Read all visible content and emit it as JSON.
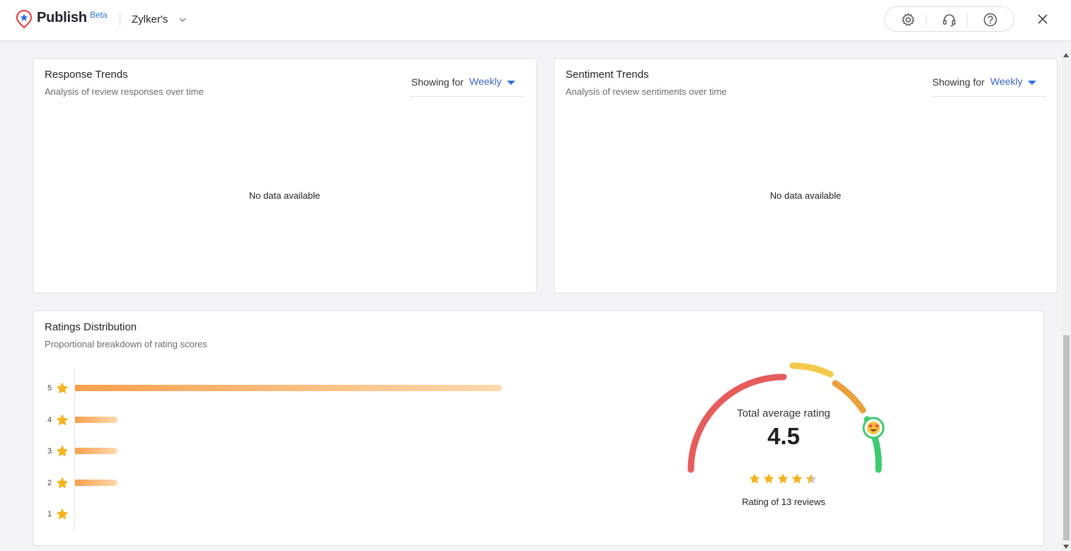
{
  "app": {
    "brand": "Publish",
    "badge": "Beta",
    "org": "Zylker's"
  },
  "header_tools": [
    "settings-icon",
    "headset-icon",
    "help-icon"
  ],
  "response_trends": {
    "title": "Response Trends",
    "subtitle": "Analysis of review responses over time",
    "showing_label": "Showing for",
    "showing_value": "Weekly",
    "empty": "No data available"
  },
  "sentiment_trends": {
    "title": "Sentiment Trends",
    "subtitle": "Analysis of review sentiments over time",
    "showing_label": "Showing for",
    "showing_value": "Weekly",
    "empty": "No data available"
  },
  "ratings": {
    "title": "Ratings Distribution",
    "subtitle": "Proportional breakdown of rating scores",
    "rows": [
      {
        "stars": "5",
        "fraction": 1.0
      },
      {
        "stars": "4",
        "fraction": 0.1
      },
      {
        "stars": "3",
        "fraction": 0.1
      },
      {
        "stars": "2",
        "fraction": 0.1
      },
      {
        "stars": "1",
        "fraction": 0.0
      }
    ],
    "gauge_title": "Total average rating",
    "average": "4.5",
    "average_value": 4.5,
    "count_text": "Rating of 13 reviews",
    "colors": {
      "red": "#e65c5c",
      "yellow": "#f4c94a",
      "orange": "#eba03d",
      "green": "#3ccb6e",
      "star": "#f5b31f"
    }
  }
}
